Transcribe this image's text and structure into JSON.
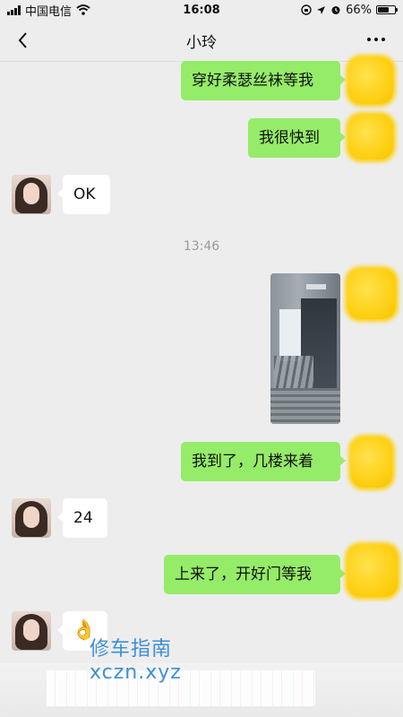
{
  "status_bar": {
    "carrier": "中国电信",
    "time": "16:08",
    "battery_percent_label": "66%",
    "battery_level": 0.66
  },
  "nav": {
    "title": "小玲"
  },
  "messages": [
    {
      "from": "me",
      "type": "text",
      "text": "穿好柔瑟丝袜等我"
    },
    {
      "from": "me",
      "type": "text",
      "text": "我很快到"
    },
    {
      "from": "other",
      "type": "text",
      "text": "OK"
    },
    {
      "type": "timestamp",
      "text": "13:46"
    },
    {
      "from": "me",
      "type": "image"
    },
    {
      "from": "me",
      "type": "text",
      "text": "我到了，几楼来着"
    },
    {
      "from": "other",
      "type": "text",
      "text": "24"
    },
    {
      "from": "me",
      "type": "text",
      "text": "上来了，开好门等我"
    },
    {
      "from": "other",
      "type": "emoji",
      "text": "👌"
    }
  ],
  "watermark": {
    "line1": "修车指南",
    "line2": "xczn.xyz"
  },
  "colors": {
    "background": "#ededed",
    "outgoing_bubble": "#95ec69",
    "incoming_bubble": "#ffffff",
    "avatar_blur": "#ffd21a",
    "watermark": "#3d8fd6"
  }
}
